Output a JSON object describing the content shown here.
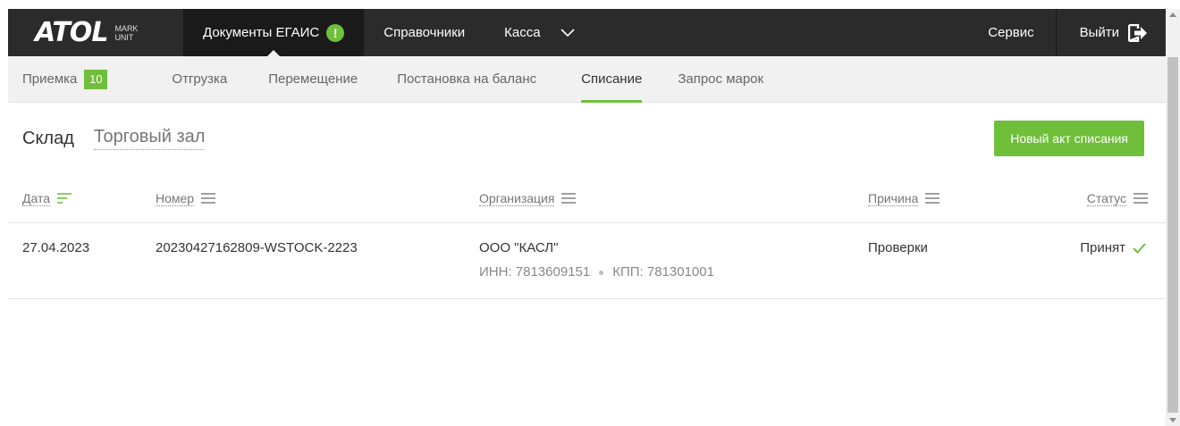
{
  "topnav": {
    "logo_text": "ATOL",
    "logo_sub1": "MARK",
    "logo_sub2": "UNIT",
    "items": [
      {
        "label": "Документы ЕГАИС",
        "alert": "!"
      },
      {
        "label": "Справочники"
      },
      {
        "label": "Касса"
      }
    ],
    "more_icon": "chevron-down-icon",
    "service": "Сервис",
    "logout": "Выйти"
  },
  "subnav": {
    "items": [
      {
        "label": "Приемка",
        "badge": "10"
      },
      {
        "label": "Отгрузка"
      },
      {
        "label": "Перемещение"
      },
      {
        "label": "Постановка на баланс"
      },
      {
        "label": "Списание"
      },
      {
        "label": "Запрос марок"
      }
    ],
    "active": "Списание"
  },
  "toolbar": {
    "tab_warehouse": "Склад",
    "tab_hall": "Торговый зал",
    "new_button": "Новый акт списания"
  },
  "table": {
    "headers": {
      "date": "Дата",
      "number": "Номер",
      "org": "Организация",
      "reason": "Причина",
      "status": "Статус"
    },
    "rows": [
      {
        "date": "27.04.2023",
        "number": "20230427162809-WSTOCK-2223",
        "org": "ООО \"КАСЛ\"",
        "inn": "ИНН: 7813609151",
        "kpp": "КПП: 781301001",
        "reason": "Проверки",
        "status": "Принят"
      }
    ]
  },
  "colors": {
    "accent": "#6fbf3b",
    "topbar": "#2b2b2b",
    "subnav": "#f1f1f1"
  }
}
